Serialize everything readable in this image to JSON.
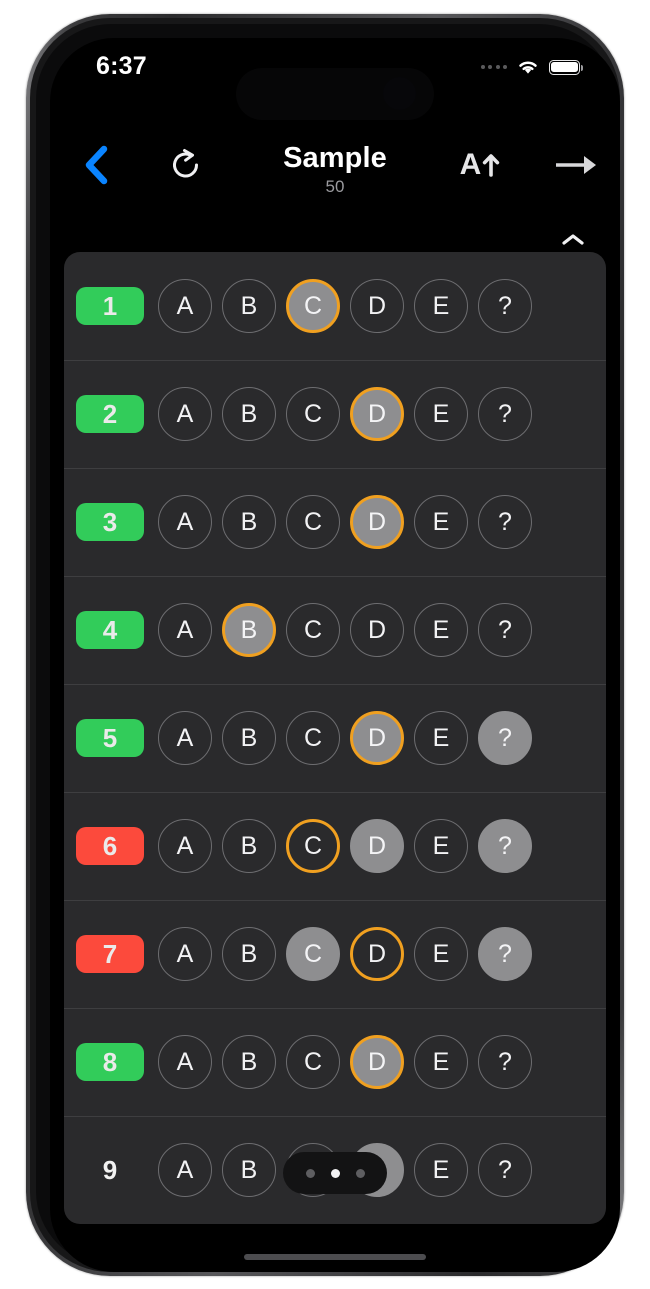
{
  "status_bar": {
    "time": "6:37",
    "cellular_icon": "cellular-dots-icon",
    "wifi_icon": "wifi-icon",
    "battery_icon": "battery-icon"
  },
  "nav": {
    "back_icon": "chevron-left-icon",
    "refresh_icon": "refresh-icon",
    "title": "Sample",
    "subtitle": "50",
    "font_size_label": "A",
    "font_size_icon": "arrow-up-icon",
    "forward_icon": "arrow-right-icon",
    "stepper_icon": "chevron-up-down-icon"
  },
  "legend": {
    "option_labels": [
      "A",
      "B",
      "C",
      "D",
      "E",
      "?"
    ],
    "state_none": "none",
    "state_filled": "filled",
    "state_ring": "ring",
    "state_ring_filled": "ring-filled"
  },
  "colors": {
    "correct_badge": "#32cc5a",
    "wrong_badge": "#fc4a3c",
    "selection_ring": "#f0a020",
    "filled_option": "#8e8e90",
    "list_background": "#2a2a2c",
    "screen_background": "#000000",
    "accent_blue": "#0a84ff"
  },
  "page_indicator": {
    "dots": 3,
    "active_index": 1
  },
  "rows": [
    {
      "number": "1",
      "status": "correct",
      "options": [
        {
          "label": "A",
          "state": "none"
        },
        {
          "label": "B",
          "state": "none"
        },
        {
          "label": "C",
          "state": "ring-filled"
        },
        {
          "label": "D",
          "state": "none"
        },
        {
          "label": "E",
          "state": "none"
        },
        {
          "label": "?",
          "state": "none"
        }
      ]
    },
    {
      "number": "2",
      "status": "correct",
      "options": [
        {
          "label": "A",
          "state": "none"
        },
        {
          "label": "B",
          "state": "none"
        },
        {
          "label": "C",
          "state": "none"
        },
        {
          "label": "D",
          "state": "ring-filled"
        },
        {
          "label": "E",
          "state": "none"
        },
        {
          "label": "?",
          "state": "none"
        }
      ]
    },
    {
      "number": "3",
      "status": "correct",
      "options": [
        {
          "label": "A",
          "state": "none"
        },
        {
          "label": "B",
          "state": "none"
        },
        {
          "label": "C",
          "state": "none"
        },
        {
          "label": "D",
          "state": "ring-filled"
        },
        {
          "label": "E",
          "state": "none"
        },
        {
          "label": "?",
          "state": "none"
        }
      ]
    },
    {
      "number": "4",
      "status": "correct",
      "options": [
        {
          "label": "A",
          "state": "none"
        },
        {
          "label": "B",
          "state": "ring-filled"
        },
        {
          "label": "C",
          "state": "none"
        },
        {
          "label": "D",
          "state": "none"
        },
        {
          "label": "E",
          "state": "none"
        },
        {
          "label": "?",
          "state": "none"
        }
      ]
    },
    {
      "number": "5",
      "status": "correct",
      "options": [
        {
          "label": "A",
          "state": "none"
        },
        {
          "label": "B",
          "state": "none"
        },
        {
          "label": "C",
          "state": "none"
        },
        {
          "label": "D",
          "state": "ring-filled"
        },
        {
          "label": "E",
          "state": "none"
        },
        {
          "label": "?",
          "state": "filled"
        }
      ]
    },
    {
      "number": "6",
      "status": "wrong",
      "options": [
        {
          "label": "A",
          "state": "none"
        },
        {
          "label": "B",
          "state": "none"
        },
        {
          "label": "C",
          "state": "ring"
        },
        {
          "label": "D",
          "state": "filled"
        },
        {
          "label": "E",
          "state": "none"
        },
        {
          "label": "?",
          "state": "filled"
        }
      ]
    },
    {
      "number": "7",
      "status": "wrong",
      "options": [
        {
          "label": "A",
          "state": "none"
        },
        {
          "label": "B",
          "state": "none"
        },
        {
          "label": "C",
          "state": "filled"
        },
        {
          "label": "D",
          "state": "ring"
        },
        {
          "label": "E",
          "state": "none"
        },
        {
          "label": "?",
          "state": "filled"
        }
      ]
    },
    {
      "number": "8",
      "status": "correct",
      "options": [
        {
          "label": "A",
          "state": "none"
        },
        {
          "label": "B",
          "state": "none"
        },
        {
          "label": "C",
          "state": "none"
        },
        {
          "label": "D",
          "state": "ring-filled"
        },
        {
          "label": "E",
          "state": "none"
        },
        {
          "label": "?",
          "state": "none"
        }
      ]
    },
    {
      "number": "9",
      "status": "plain",
      "options": [
        {
          "label": "A",
          "state": "none"
        },
        {
          "label": "B",
          "state": "none"
        },
        {
          "label": "C",
          "state": "none"
        },
        {
          "label": "D",
          "state": "filled"
        },
        {
          "label": "E",
          "state": "none"
        },
        {
          "label": "?",
          "state": "none"
        }
      ]
    }
  ]
}
